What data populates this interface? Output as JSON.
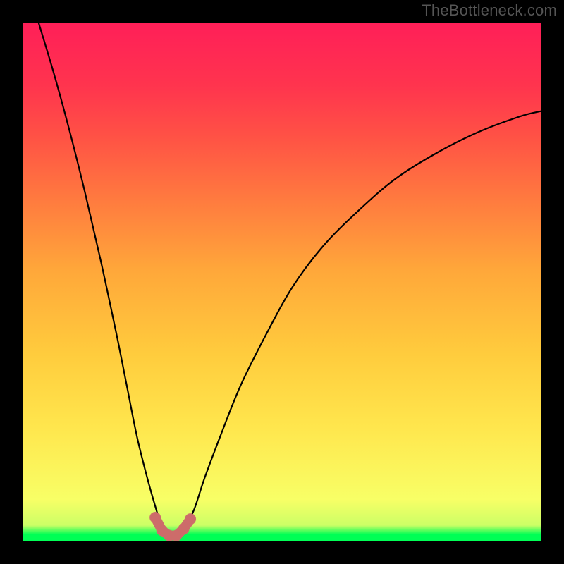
{
  "watermark": "TheBottleneck.com",
  "chart_data": {
    "type": "line",
    "title": "",
    "xlabel": "",
    "ylabel": "",
    "xlim": [
      0,
      100
    ],
    "ylim": [
      0,
      100
    ],
    "grid": false,
    "series": [
      {
        "name": "bottleneck-curve",
        "x": [
          3,
          6,
          9,
          12,
          15,
          18,
          20,
          22,
          24,
          26,
          27,
          28,
          29.5,
          31,
          33,
          35,
          38,
          42,
          47,
          52,
          58,
          65,
          72,
          80,
          88,
          96,
          100
        ],
        "values": [
          100,
          90,
          79,
          67,
          54,
          40,
          30,
          20,
          12,
          5,
          2,
          0.5,
          0.5,
          2,
          6,
          12,
          20,
          30,
          40,
          49,
          57,
          64,
          70,
          75,
          79,
          82,
          83
        ]
      }
    ],
    "markers": {
      "name": "optimal-region",
      "x": [
        25.5,
        26.8,
        28.2,
        29.6,
        31.0,
        32.3
      ],
      "values": [
        4.5,
        2.0,
        1.0,
        1.0,
        2.3,
        4.2
      ]
    },
    "colors": {
      "curve": "#000000",
      "marker": "#cc6d6a",
      "gradient_top": "#ff1f58",
      "gradient_mid": "#ffe64d",
      "gradient_bottom": "#00ff55"
    }
  }
}
